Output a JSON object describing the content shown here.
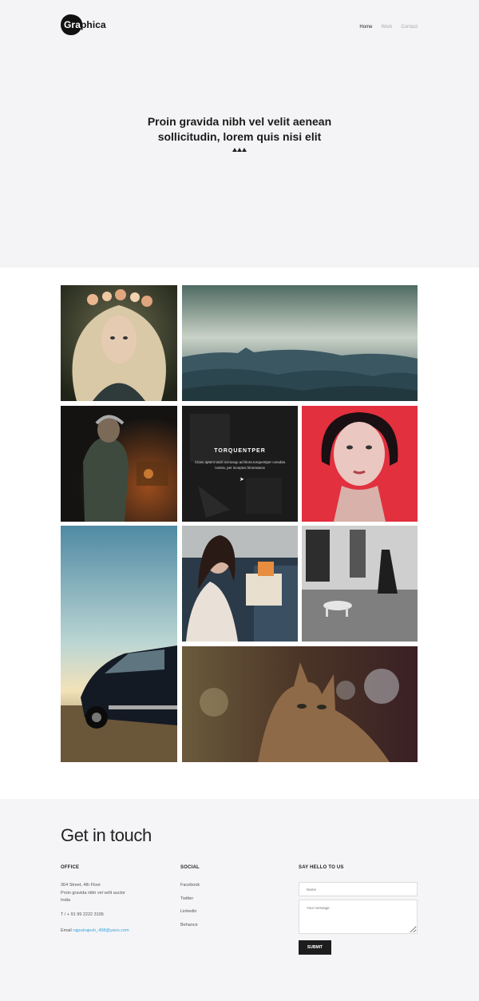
{
  "brand": {
    "logo_part1": "Gra",
    "logo_part2": "phica"
  },
  "nav": {
    "items": [
      {
        "label": "Home"
      },
      {
        "label": "Work"
      },
      {
        "label": "Contact"
      }
    ]
  },
  "hero": {
    "title_line1": "Proin gravida nibh vel velit aenean",
    "title_line2": "sollicitudin, lorem quis nisi elit"
  },
  "gallery": {
    "overlay": {
      "title": "TORQUENTPER",
      "description": "Class aptent taciti sociosqu ad litora torquentper conubia nostra, per inceptos himenaeos"
    }
  },
  "contact": {
    "heading": "Get in touch",
    "office": {
      "title": "OFFICE",
      "address_line1": "364 Street, 4th Floor",
      "address_line2": "Proin gravida nibh vel velit auctor",
      "address_line3": "India",
      "phone": "T / + 91 99 2222 3195",
      "email_label": "Email",
      "email": "rajputrajesh_498@yaoo.com"
    },
    "social": {
      "title": "SOCIAL",
      "links": [
        {
          "label": "Facebook"
        },
        {
          "label": "Twitter"
        },
        {
          "label": "Linkedin"
        },
        {
          "label": "Behance"
        }
      ]
    },
    "form": {
      "title": "SAY HELLO TO US",
      "name_placeholder": "Name",
      "message_placeholder": "Your message",
      "submit_label": "SUBMIT"
    }
  },
  "colors": {
    "accent_link": "#3aa3d8",
    "dark": "#1d1d1d",
    "hero_bg": "#f4f4f6"
  }
}
